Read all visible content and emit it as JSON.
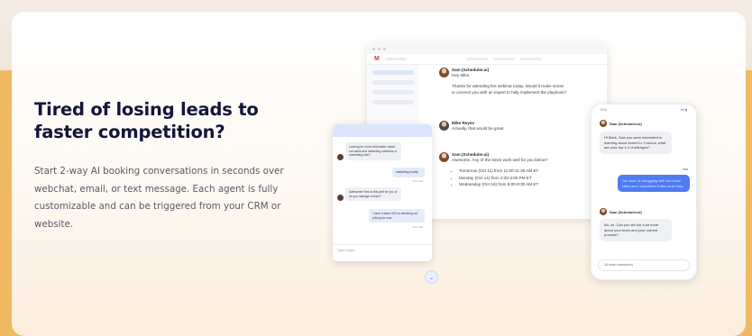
{
  "hero": {
    "headline": "Tired of losing leads to faster competition?",
    "body": "Start 2-way AI booking conversations in seconds over webchat, email, or text message. Each agent is fully customizable and can be triggered from your CRM or website."
  },
  "email_preview": {
    "app_label": "Gmail",
    "messages": [
      {
        "sender": "Sam (Scheduler.ai)",
        "lines": [
          "Hey Mike,",
          "",
          "Thanks for attending the webinar today. Would it make sense",
          "to connect you with an expert to help implement the playbook?"
        ]
      },
      {
        "sender": "Mike Reyes",
        "lines": [
          "Actually, that would be great."
        ]
      },
      {
        "sender": "Sam (Scheduler.ai)",
        "lines": [
          "Awesome. Any of the times work well for you below?"
        ],
        "options": [
          "Tomorrow (Oct 11) from 11:00-11:30 AM ET",
          "Monday (Oct 14) from 2:30-3:00 PM ET",
          "Wednesday (Oct 16) from 9:00-9:30 AM ET"
        ]
      }
    ]
  },
  "webchat_preview": {
    "msg1": "Looking for more information about our sales and marketing solutions or something else?",
    "msg2": "marketing mostly",
    "time1": "10:xx AM",
    "msg3": "Awesome! How is this part for you or do you manage a team?",
    "msg4": "I have a team of 5 so checking out pricing for now",
    "time2": "10:xx AM",
    "input_placeholder": "Type a reply..."
  },
  "sms_preview": {
    "status_time": "9:41",
    "sender1": "Sam (Scheduler.ai)",
    "msg1": "Hi Mark, Saw you were interested in learning about AcmeCo. Curious, what are your top 1-2 challenges?",
    "you_label": "You",
    "msg2": "Our team is struggling with low show rates and I wondered if this could help.",
    "sender2": "Sam (Scheduler.ai)",
    "msg3": "Ah, ok. Can you tell me a bit more about your team and your current process?",
    "input_value": "10 team members|"
  }
}
